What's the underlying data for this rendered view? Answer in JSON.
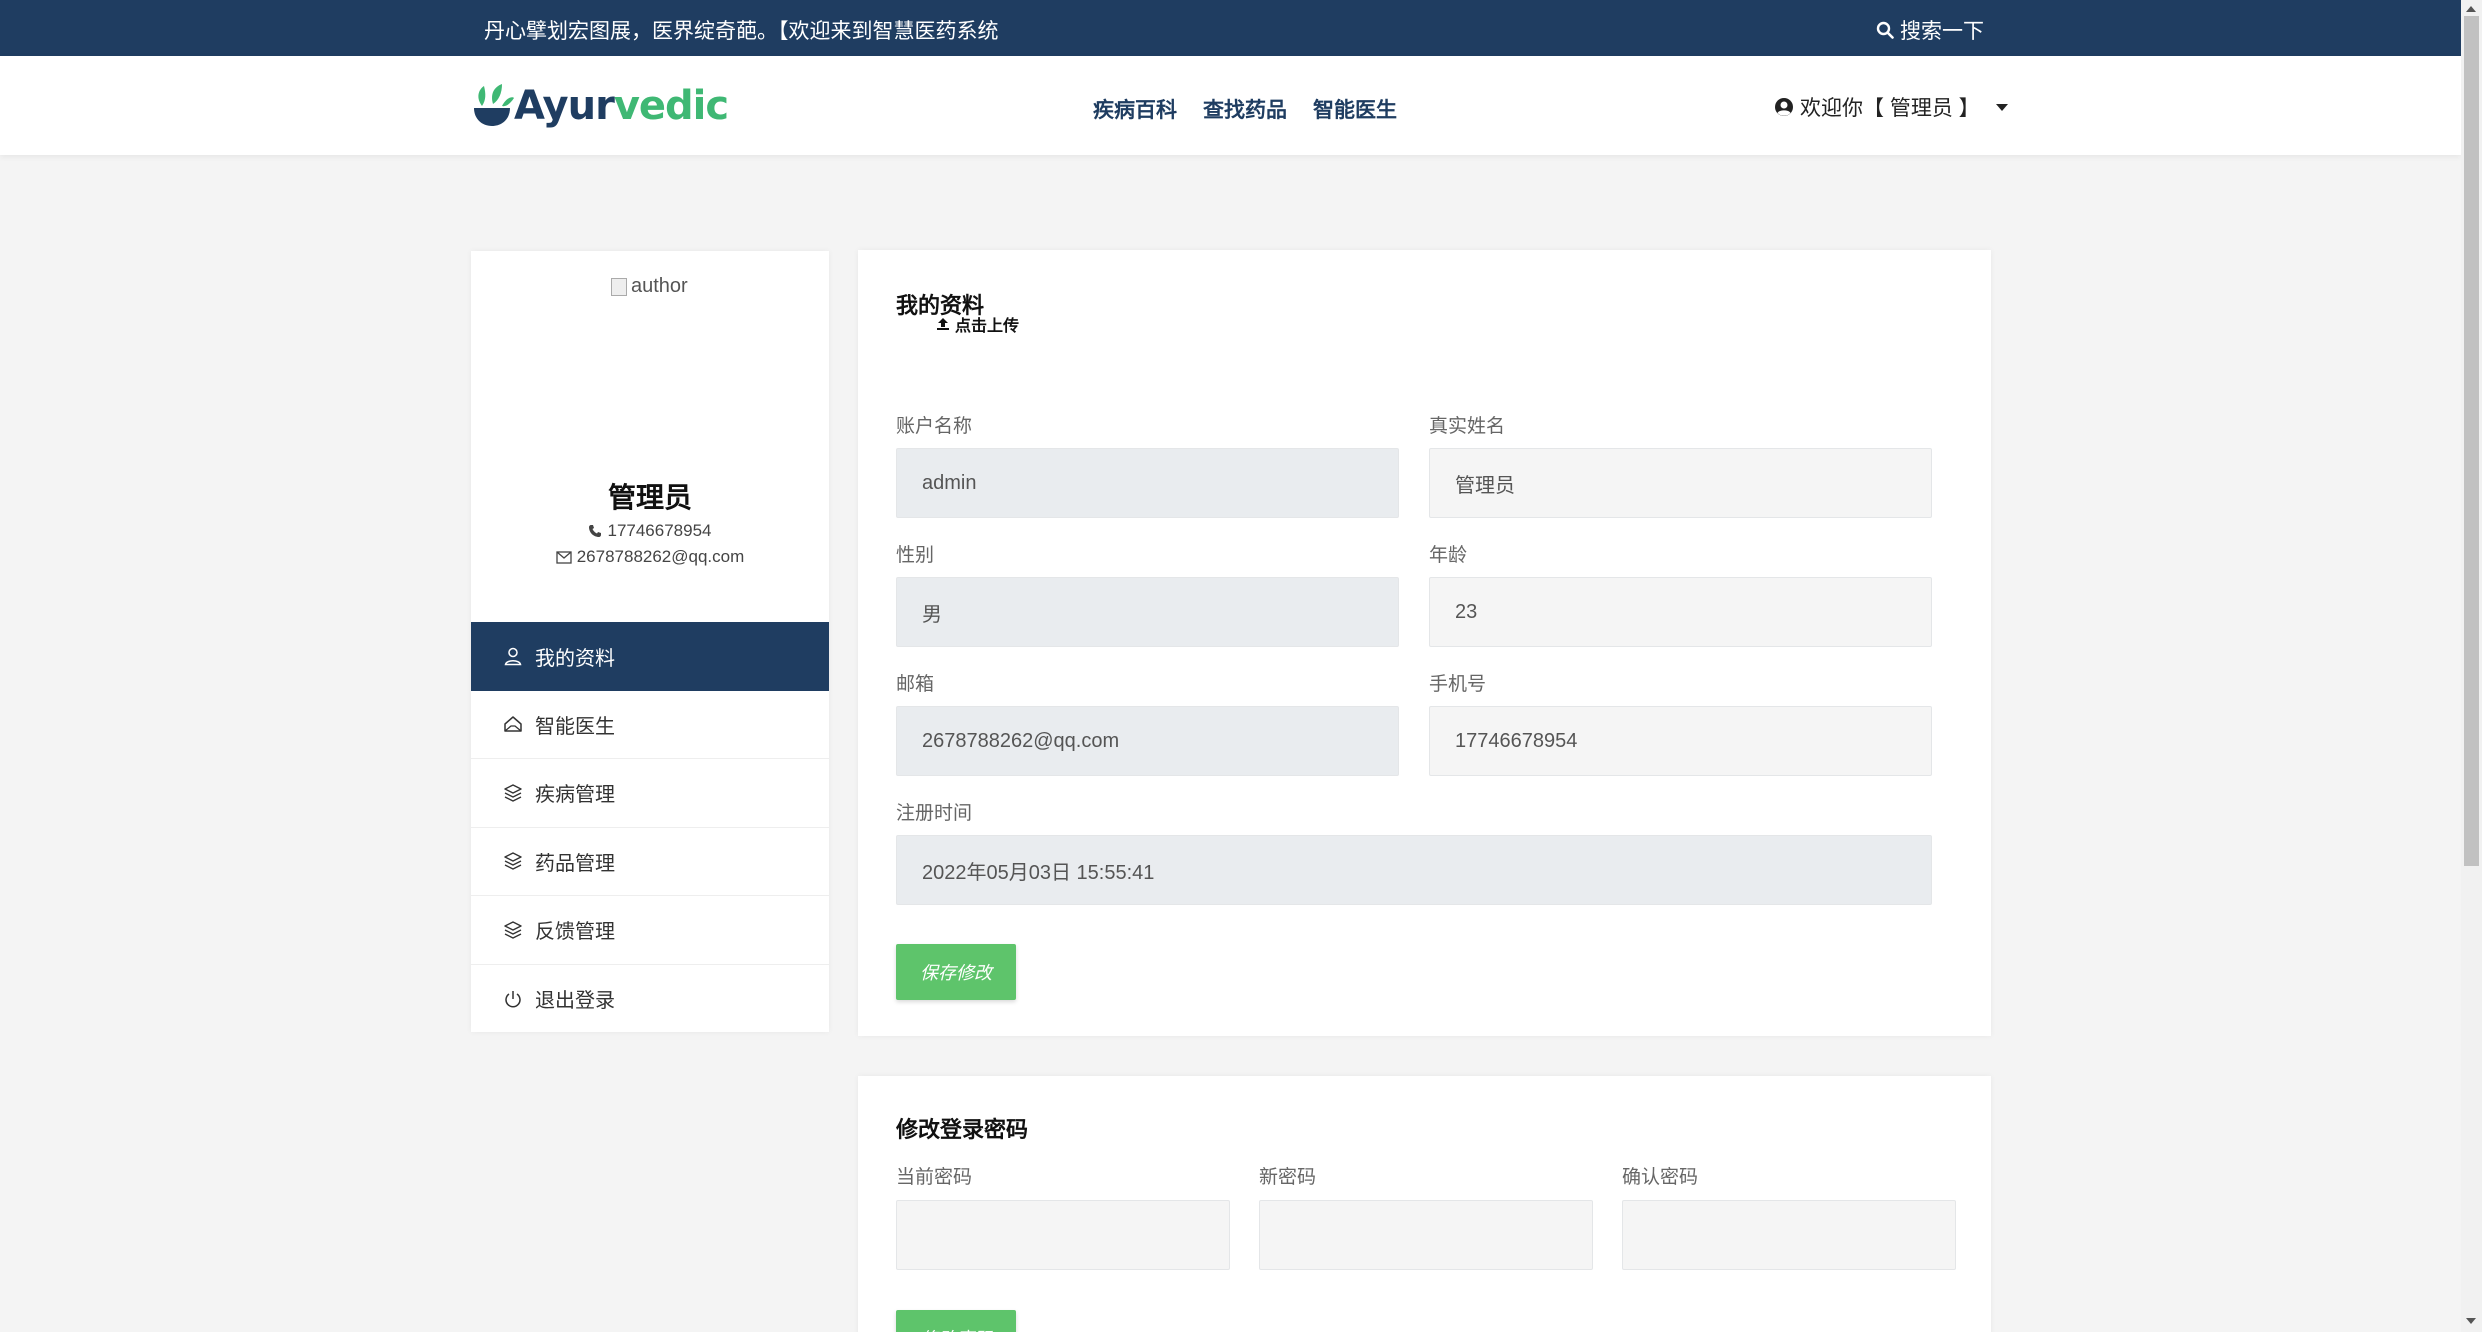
{
  "topbar": {
    "slogan": "丹心擘划宏图展，医界绽奇葩。【欢迎来到智慧医药系统",
    "search_label": "搜索一下"
  },
  "header": {
    "logo_text_1": "Ayur",
    "logo_text_2": "vedic",
    "nav": [
      "疾病百科",
      "查找药品",
      "智能医生"
    ],
    "user_greeting": "欢迎你【 管理员 】"
  },
  "sidebar": {
    "avatar_alt": "author",
    "name": "管理员",
    "phone": "17746678954",
    "email": "2678788262@qq.com",
    "menu": [
      "我的资料",
      "智能医生",
      "疾病管理",
      "药品管理",
      "反馈管理",
      "退出登录"
    ],
    "active_index": 0
  },
  "profile": {
    "title": "我的资料",
    "upload_label": "点击上传",
    "account_label": "账户名称",
    "account_value": "admin",
    "realname_label": "真实姓名",
    "realname_value": "管理员",
    "gender_label": "性别",
    "gender_value": "男",
    "age_label": "年龄",
    "age_value": "23",
    "email_label": "邮箱",
    "email_value": "2678788262@qq.com",
    "phone_label": "手机号",
    "phone_value": "17746678954",
    "regtime_label": "注册时间",
    "regtime_value": "2022年05月03日 15:55:41",
    "save_button": "保存修改"
  },
  "password": {
    "title": "修改登录密码",
    "current_label": "当前密码",
    "new_label": "新密码",
    "confirm_label": "确认密码",
    "submit_button": "修改密码"
  },
  "colors": {
    "navy": "#1f3d61",
    "green": "#5ec46b",
    "logo_green": "#3fb874"
  }
}
